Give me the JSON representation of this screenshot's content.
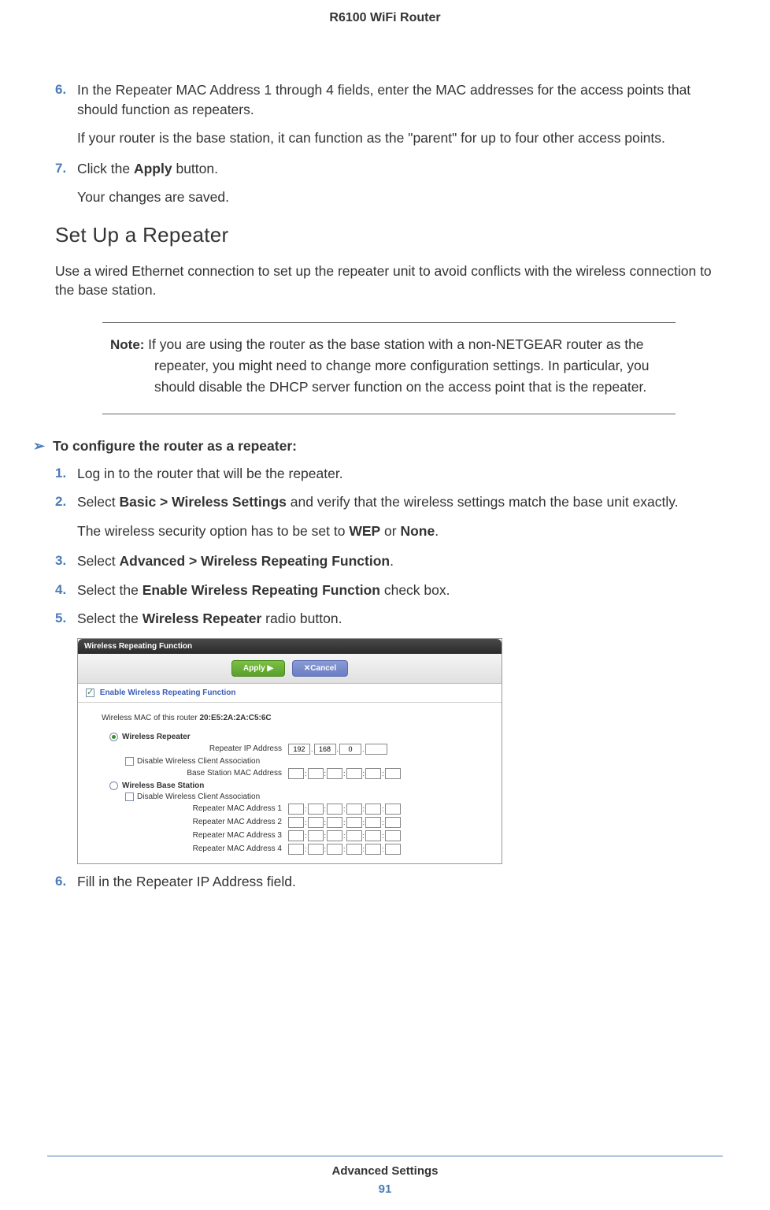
{
  "header": {
    "title": "R6100 WiFi Router"
  },
  "steps_top": {
    "s6_num": "6.",
    "s6_text": "In the Repeater MAC Address 1 through 4 fields, enter the MAC addresses for the access points that should function as repeaters.",
    "s6_sub": "If your router is the base station, it can function as the \"parent\" for up to four other access points.",
    "s7_num": "7.",
    "s7_pre": "Click the ",
    "s7_bold": "Apply",
    "s7_post": " button.",
    "s7_sub": "Your changes are saved."
  },
  "section": {
    "heading": "Set Up a Repeater",
    "intro": "Use a wired Ethernet connection to set up the repeater unit to avoid conflicts with the wireless connection to the base station."
  },
  "note": {
    "label": "Note:  ",
    "text": "If you are using the router as the base station with a non-NETGEAR router as the repeater, you might need to change more configuration settings. In particular, you should disable the DHCP server function on the access point that is the repeater."
  },
  "procedure": {
    "chevron": "➢",
    "title": "To configure the router as a repeater:",
    "s1_num": "1.",
    "s1_text": "Log in to the router that will be the repeater.",
    "s2_num": "2.",
    "s2_pre": "Select ",
    "s2_bold": "Basic > Wireless Settings",
    "s2_post": " and verify that the wireless settings match the base unit exactly.",
    "s2_sub_pre": "The wireless security option has to be set to ",
    "s2_sub_b1": "WEP",
    "s2_sub_mid": " or ",
    "s2_sub_b2": "None",
    "s2_sub_post": ".",
    "s3_num": "3.",
    "s3_pre": "Select ",
    "s3_bold": "Advanced > Wireless Repeating Function",
    "s3_post": ".",
    "s4_num": "4.",
    "s4_pre": "Select the ",
    "s4_bold": "Enable Wireless Repeating Function",
    "s4_post": " check box.",
    "s5_num": "5.",
    "s5_pre": "Select the ",
    "s5_bold": "Wireless Repeater",
    "s5_post": " radio button.",
    "s6_num": "6.",
    "s6_text": "Fill in the Repeater IP Address field."
  },
  "screenshot": {
    "header": "Wireless Repeating Function",
    "apply": "Apply ▶",
    "cancel": "✕Cancel",
    "enable": "Enable Wireless Repeating Function",
    "mac_line_pre": "Wireless MAC of this router ",
    "mac_line_val": "20:E5:2A:2A:C5:6C",
    "repeater_label": "Wireless Repeater",
    "repeater_ip_label": "Repeater IP Address",
    "ip1": "192",
    "ip2": "168",
    "ip3": "0",
    "disable_assoc": "Disable Wireless Client Association",
    "base_mac_label": "Base Station MAC Address",
    "base_station_label": "Wireless Base Station",
    "rmac1": "Repeater MAC Address 1",
    "rmac2": "Repeater MAC Address 2",
    "rmac3": "Repeater MAC Address 3",
    "rmac4": "Repeater MAC Address 4"
  },
  "footer": {
    "title": "Advanced Settings",
    "page": "91"
  }
}
